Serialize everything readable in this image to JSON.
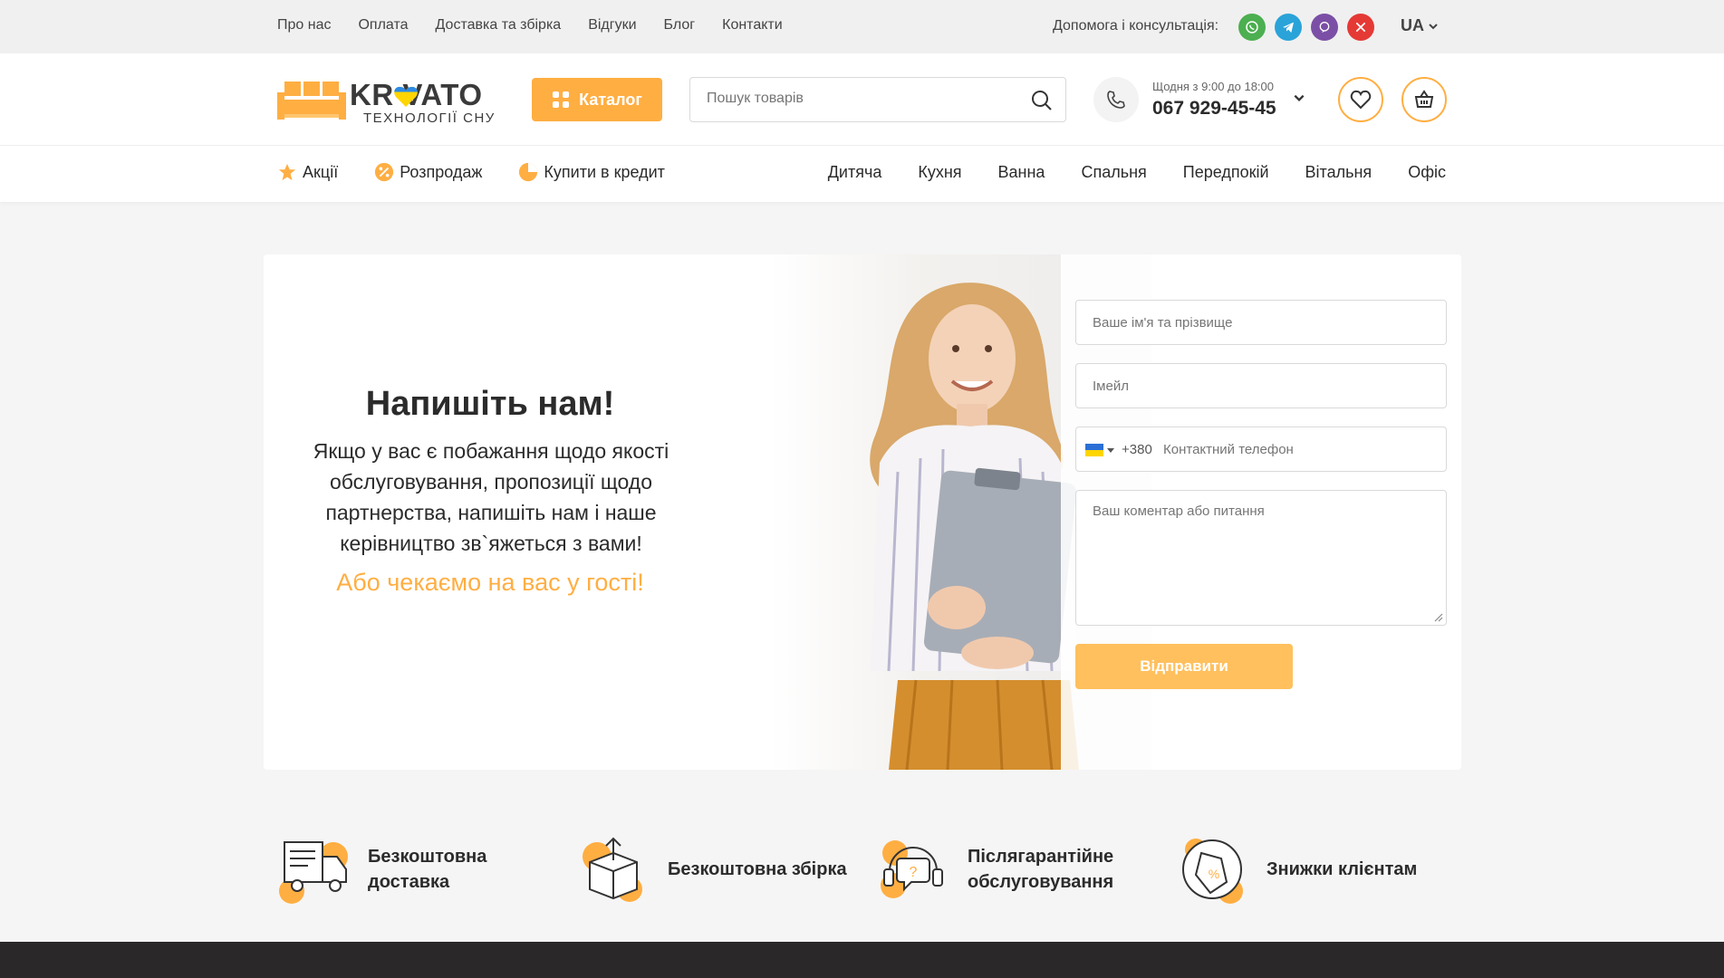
{
  "topbar": {
    "links": [
      "Про нас",
      "Оплата",
      "Доставка та збірка",
      "Відгуки",
      "Блог",
      "Контакти"
    ],
    "help_label": "Допомога і консультація:",
    "socials": [
      {
        "name": "whatsapp-icon",
        "color": "#4caf50"
      },
      {
        "name": "telegram-icon",
        "color": "#2aa3d9"
      },
      {
        "name": "viber-icon",
        "color": "#7b4fa6"
      },
      {
        "name": "x-icon",
        "color": "#e53935"
      }
    ],
    "language": "UA"
  },
  "header": {
    "logo_text": "KR VATO",
    "logo_subtitle": "ТЕХНОЛОГІЇ СНУ",
    "catalog_label": "Каталог",
    "search_placeholder": "Пошук товарів",
    "work_hours": "Щодня з 9:00 до 18:00",
    "phone": "067 929-45-45"
  },
  "nav": {
    "left": [
      "Акції",
      "Розпродаж",
      "Купити в кредит"
    ],
    "right": [
      "Дитяча",
      "Кухня",
      "Ванна",
      "Спальня",
      "Передпокій",
      "Вітальня",
      "Офіс"
    ]
  },
  "hero": {
    "title": "Напишіть нам!",
    "body": "Якщо у вас є побажання щодо якості обслуговування, пропозиції щодо партнерства, напишіть нам і наше керівництво зв`яжеться з вами!",
    "accent": "Або чекаємо на вас у гості!"
  },
  "form": {
    "name_placeholder": "Ваше ім'я та прізвище",
    "email_placeholder": "Імейл",
    "phone_prefix": "+380",
    "phone_placeholder": "Контактний телефон",
    "comment_placeholder": "Ваш коментар або питання",
    "submit_label": "Відправити"
  },
  "benefits": [
    {
      "icon": "delivery-truck-icon",
      "label": "Безкоштовна доставка"
    },
    {
      "icon": "box-assembly-icon",
      "label": "Безкоштовна збірка"
    },
    {
      "icon": "support-headset-icon",
      "label": "Післягарантійне обслуговування"
    },
    {
      "icon": "discount-tag-icon",
      "label": "Знижки клієнтам"
    }
  ],
  "colors": {
    "accent": "#ffae42",
    "button_light": "#ffc05d",
    "footer": "#2a2828"
  }
}
